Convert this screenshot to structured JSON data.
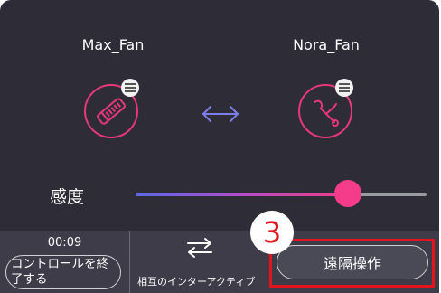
{
  "users": {
    "left": {
      "name": "Max_Fan"
    },
    "right": {
      "name": "Nora_Fan"
    }
  },
  "icons": {
    "left_device": "toy-device-icon",
    "right_device": "rabbit-toy-icon",
    "menu": "menu-icon",
    "link": "bidirectional-arrow-icon",
    "swap": "swap-arrows-icon"
  },
  "sensitivity": {
    "label": "感度",
    "level": 0.73
  },
  "bottom_bar": {
    "timer": "00:09",
    "end_control_label": "コントロールを終了する",
    "interactive_label": "相互のインターアクティブ",
    "remote_control_label": "遠隔操作"
  },
  "annotation": {
    "step_number": "3"
  },
  "colors": {
    "background": "#2d2c37",
    "accent": "#f43c8a",
    "highlight": "#e3141b"
  }
}
